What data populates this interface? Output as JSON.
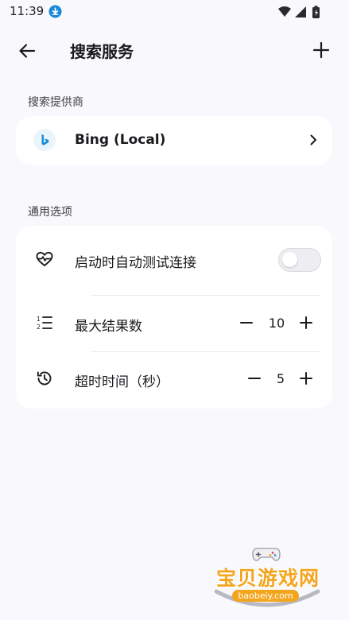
{
  "status_bar": {
    "time": "11:39"
  },
  "app_bar": {
    "title": "搜索服务"
  },
  "provider_section": {
    "label": "搜索提供商",
    "provider": {
      "name": "Bing (Local)",
      "logo_color": "#1d8cd8"
    }
  },
  "options_section": {
    "label": "通用选项",
    "auto_test": {
      "label": "启动时自动测试连接",
      "enabled": false
    },
    "max_results": {
      "label": "最大结果数",
      "value": "10"
    },
    "timeout": {
      "label": "超时时间（秒）",
      "value": "5"
    }
  },
  "watermark": {
    "text": "宝贝游戏网",
    "domain": "baobeiy.com"
  },
  "colors": {
    "background": "#f9f8fd",
    "card": "#ffffff",
    "watermark": "#f3a51e"
  }
}
